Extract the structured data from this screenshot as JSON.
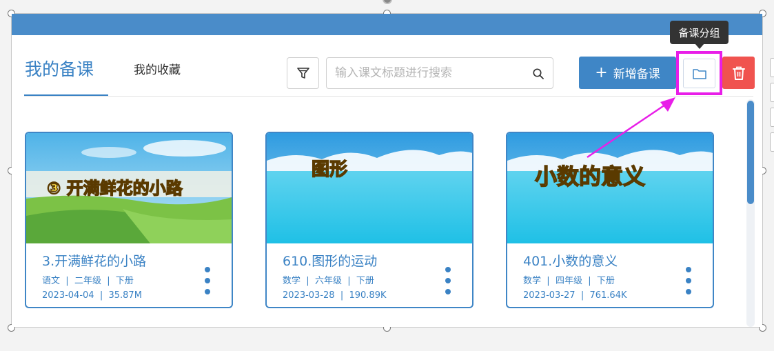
{
  "tabs": {
    "active": "我的备课",
    "other": "我的收藏"
  },
  "search": {
    "placeholder": "输入课文标题进行搜索"
  },
  "toolbar": {
    "add_label": "新增备课",
    "add_icon": "plus-icon",
    "filter_icon": "filter-icon",
    "folder_icon": "folder-icon",
    "delete_icon": "trash-icon",
    "folder_tooltip": "备课分组"
  },
  "colors": {
    "primary": "#3f86c6",
    "topbar": "#4a8cc9",
    "danger": "#f0534f",
    "highlight": "#e81ee8"
  },
  "cards": [
    {
      "title": "3.开满鲜花的小路",
      "thumb_text": "③ 开满鲜花的小路",
      "subject": "语文",
      "grade": "二年级",
      "volume": "下册",
      "date": "2023-04-04",
      "size": "35.87M"
    },
    {
      "title": "610.图形的运动",
      "thumb_text": "图形",
      "subject": "数学",
      "grade": "六年级",
      "volume": "下册",
      "date": "2023-03-28",
      "size": "190.89K"
    },
    {
      "title": "401.小数的意义",
      "thumb_text": "小数的意义",
      "subject": "数学",
      "grade": "四年级",
      "volume": "下册",
      "date": "2023-03-27",
      "size": "761.64K"
    }
  ]
}
